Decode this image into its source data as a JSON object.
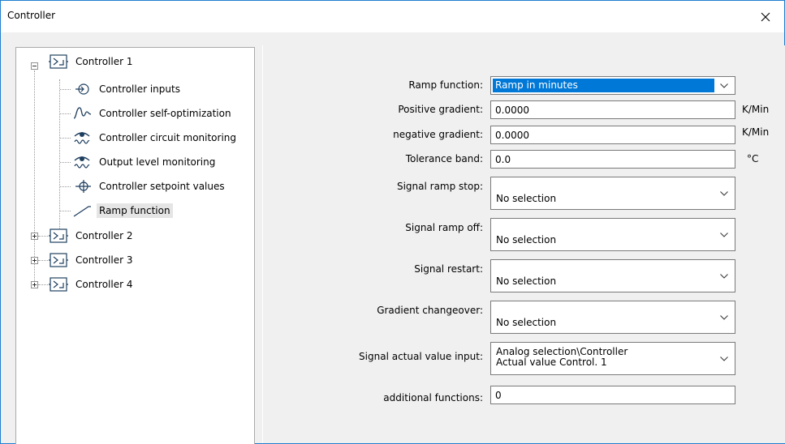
{
  "window": {
    "title": "Controller"
  },
  "tree": {
    "root1": {
      "label": "Controller 1"
    },
    "children": [
      {
        "label": "Controller inputs"
      },
      {
        "label": "Controller self-optimization"
      },
      {
        "label": "Controller circuit monitoring"
      },
      {
        "label": "Output level monitoring"
      },
      {
        "label": "Controller setpoint values"
      },
      {
        "label": "Ramp function"
      }
    ],
    "others": [
      {
        "label": "Controller 2"
      },
      {
        "label": "Controller 3"
      },
      {
        "label": "Controller 4"
      }
    ]
  },
  "form": {
    "ramp_function": {
      "label": "Ramp function:",
      "value": "Ramp in minutes"
    },
    "positive_gradient": {
      "label": "Positive gradient:",
      "value": "0.0000",
      "unit": "K/Min"
    },
    "negative_gradient": {
      "label": "negative gradient:",
      "value": "0.0000",
      "unit": "K/Min"
    },
    "tolerance_band": {
      "label": "Tolerance band:",
      "value": "0.0",
      "unit": "°C"
    },
    "signal_ramp_stop": {
      "label": "Signal ramp stop:",
      "value": "No selection"
    },
    "signal_ramp_off": {
      "label": "Signal ramp off:",
      "value": "No selection"
    },
    "signal_restart": {
      "label": "Signal restart:",
      "value": "No selection"
    },
    "gradient_changeover": {
      "label": "Gradient changeover:",
      "value": "No selection"
    },
    "signal_actual_value_input": {
      "label": "Signal actual value input:",
      "line1": "Analog selection\\Controller",
      "line2": "Actual value Control. 1"
    },
    "additional_functions": {
      "label": "additional functions:",
      "value": "0"
    }
  },
  "colors": {
    "accent": "#0078d7",
    "window_border": "#1e7fd0",
    "panel_bg": "#f0f0f0"
  }
}
